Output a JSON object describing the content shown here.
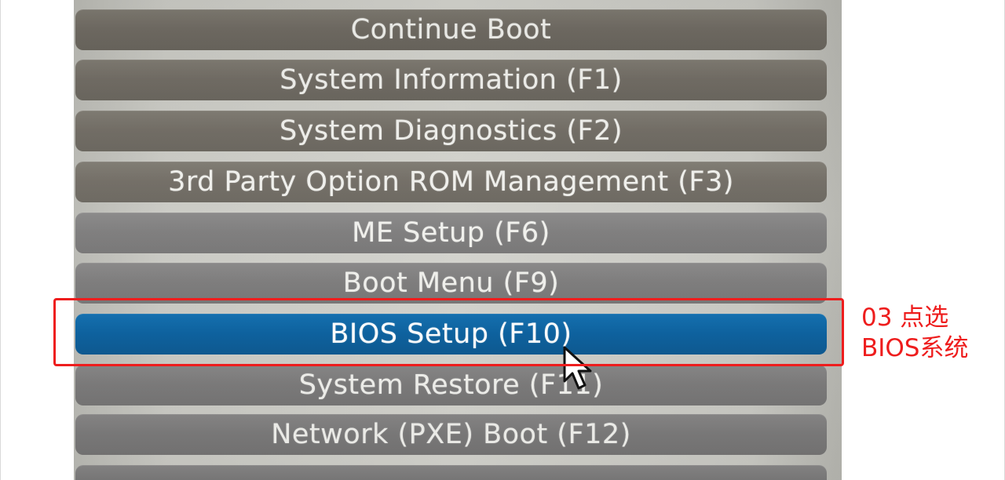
{
  "boot_menu": {
    "items": [
      {
        "label": "Continue Boot",
        "state": "normal"
      },
      {
        "label": "System Information (F1)",
        "state": "normal"
      },
      {
        "label": "System Diagnostics (F2)",
        "state": "normal"
      },
      {
        "label": "3rd Party Option ROM Management (F3)",
        "state": "normal"
      },
      {
        "label": "ME Setup (F6)",
        "state": "normal"
      },
      {
        "label": "Boot Menu (F9)",
        "state": "normal"
      },
      {
        "label": "BIOS Setup (F10)",
        "state": "selected"
      },
      {
        "label": "System Restore (F11)",
        "state": "normal"
      },
      {
        "label": "Network (PXE) Boot (F12)",
        "state": "normal"
      }
    ],
    "selected_color": "#075e9d",
    "item_color": "#6f6a62"
  },
  "annotation": {
    "line1": "03 点选",
    "line2": "BIOS系统",
    "color": "#ee1d1d"
  },
  "icons": {
    "cursor": "mouse-pointer-icon"
  }
}
